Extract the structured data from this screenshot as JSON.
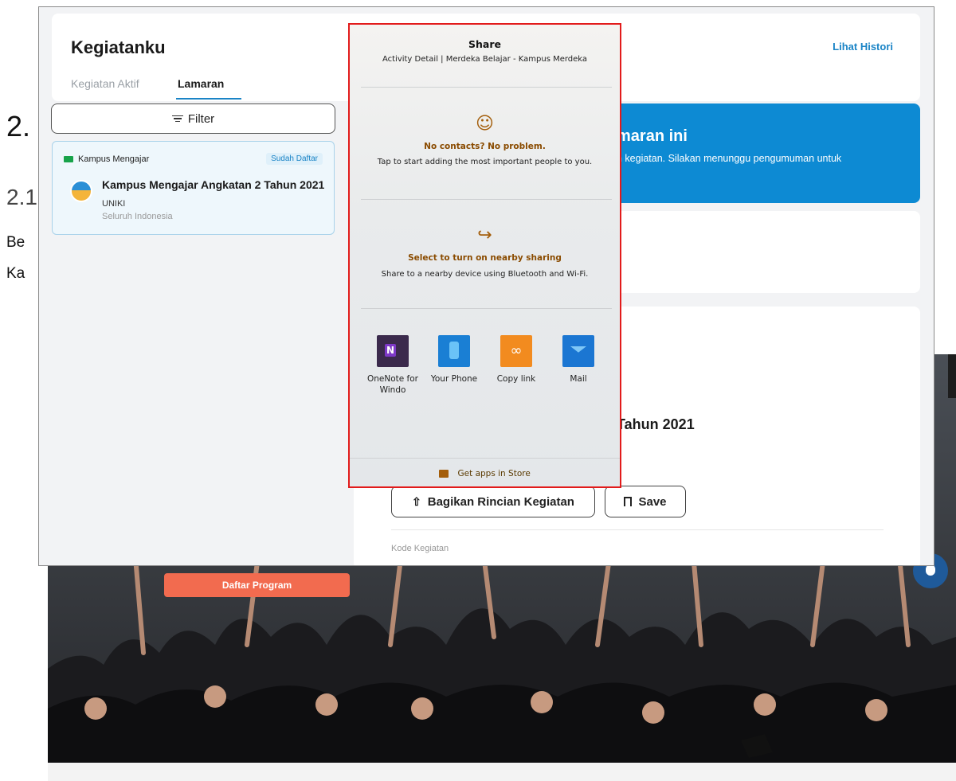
{
  "document_bg": {
    "heading_2": "2.",
    "heading_3": "2.1",
    "line_1": "Be",
    "line_2": "Ka"
  },
  "app": {
    "title": "Kegiatanku",
    "history_link": "Lihat Histori",
    "tabs": [
      {
        "label": "Kegiatan Aktif",
        "active": false
      },
      {
        "label": "Lamaran",
        "active": true
      }
    ],
    "filter_label": "Filter",
    "program_card": {
      "program": "Kampus Mengajar",
      "status": "Sudah Daftar",
      "activity_title": "Kampus Mengajar Angkatan 2 Tahun 2021",
      "organization": "UNIKI",
      "location": "Seluruh Indonesia"
    },
    "banner": {
      "title": "maran ini",
      "text": "n kegiatan. Silakan menunggu pengumuman untuk"
    },
    "detail": {
      "title_fragment": "Tahun 2021",
      "share_button": "Bagikan Rincian Kegiatan",
      "save_button": "Save",
      "kode_label": "Kode Kegiatan"
    }
  },
  "share_dialog": {
    "title": "Share",
    "subtitle": "Activity Detail | Merdeka Belajar - Kampus Merdeka",
    "contacts_heading": "No contacts? No problem.",
    "contacts_desc": "Tap to start adding the most important people to you.",
    "nearby_heading": "Select to turn on nearby sharing",
    "nearby_desc": "Share to a nearby device using Bluetooth and Wi-Fi.",
    "apps": [
      {
        "label": "OneNote for Windo",
        "icon": "onenote-icon"
      },
      {
        "label": "Your Phone",
        "icon": "your-phone-icon"
      },
      {
        "label": "Copy link",
        "icon": "copy-link-icon"
      },
      {
        "label": "Mail",
        "icon": "mail-icon"
      }
    ],
    "store_link": "Get apps in Store"
  },
  "hero": {
    "cta_button": "Daftar Program"
  },
  "colors": {
    "accent_blue": "#1a84c6",
    "banner_blue": "#0d8ad3",
    "cta_orange": "#f26b4f",
    "highlight_red": "#e21b1b"
  }
}
